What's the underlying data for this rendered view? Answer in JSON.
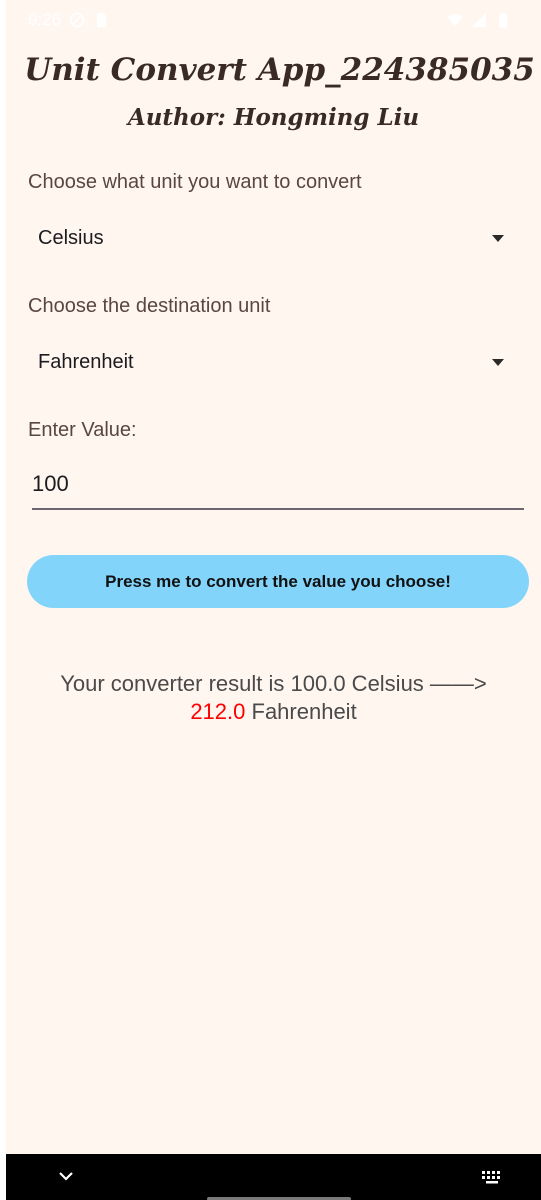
{
  "status_bar": {
    "time": "9:26",
    "icons": [
      "do-not-disturb-icon",
      "sim-card-icon",
      "wifi-icon",
      "signal-icon",
      "battery-icon"
    ]
  },
  "header": {
    "title": "Unit Convert App_224385035",
    "author": "Author: Hongming Liu"
  },
  "source": {
    "label": "Choose what unit you want to convert",
    "selected": "Celsius"
  },
  "destination": {
    "label": "Choose the destination unit",
    "selected": "Fahrenheit"
  },
  "value": {
    "label": "Enter Value:",
    "current": "100"
  },
  "convert_button": {
    "label": "Press me to convert the value you choose!"
  },
  "result": {
    "prefix": "Your converter result is 100.0 Celsius ——>",
    "value": "212.0",
    "unit": "Fahrenheit"
  },
  "colors": {
    "background": "#fff6f0",
    "button": "#83d4fb",
    "result_value": "#ff0000",
    "title": "#3a2a26"
  },
  "nav_bar": {
    "icons": [
      "chevron-down-icon",
      "keyboard-icon"
    ]
  }
}
